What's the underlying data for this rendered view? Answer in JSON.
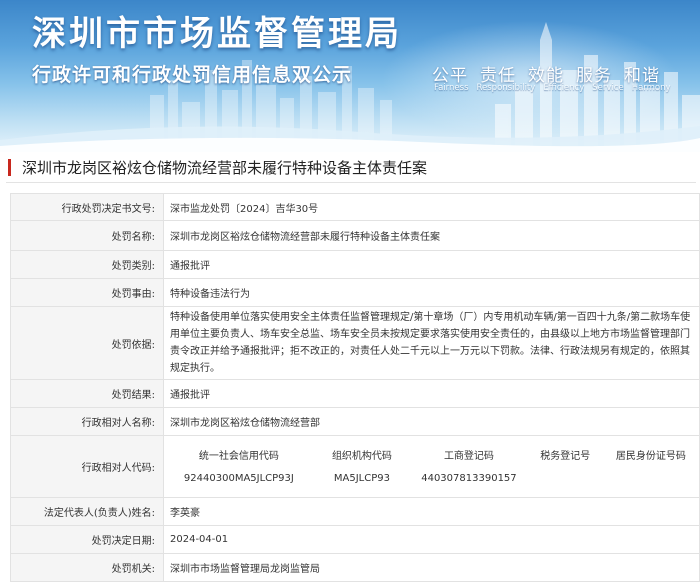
{
  "banner": {
    "title": "深圳市市场监督管理局",
    "subtitle": "行政许可和行政处罚信用信息双公示",
    "slogans": [
      "公平",
      "责任",
      "效能",
      "服务",
      "和谐"
    ],
    "slogans_en": [
      "Fairness",
      "Responsibility",
      "Efficiency",
      "Service",
      "Harmony"
    ]
  },
  "case_title": "深圳市龙岗区裕炫仓储物流经营部未履行特种设备主体责任案",
  "rows": {
    "decision_no": {
      "label": "行政处罚决定书文号:",
      "value": "深市监龙处罚〔2024〕吉华30号"
    },
    "penalty_name": {
      "label": "处罚名称:",
      "value": "深圳市龙岗区裕炫仓储物流经营部未履行特种设备主体责任案"
    },
    "penalty_type": {
      "label": "处罚类别:",
      "value": "通报批评"
    },
    "penalty_reason": {
      "label": "处罚事由:",
      "value": "特种设备违法行为"
    },
    "penalty_basis": {
      "label": "处罚依据:",
      "value": "特种设备使用单位落实使用安全主体责任监督管理规定/第十章场（厂）内专用机动车辆/第一百四十九条/第二款场车使用单位主要负责人、场车安全总监、场车安全员未按规定要求落实使用安全责任的，由县级以上地方市场监督管理部门责令改正并给予通报批评；拒不改正的，对责任人处二千元以上一万元以下罚款。法律、行政法规另有规定的，依照其规定执行。"
    },
    "penalty_result": {
      "label": "处罚结果:",
      "value": "通报批评"
    },
    "counterparty": {
      "label": "行政相对人名称:",
      "value": "深圳市龙岗区裕炫仓储物流经营部"
    },
    "counterparty_code": {
      "label": "行政相对人代码:",
      "headers": [
        "统一社会信用代码",
        "组织机构代码",
        "工商登记码",
        "税务登记号",
        "居民身份证号码"
      ],
      "values": [
        "92440300MA5JLCP93J",
        "MA5JLCP93",
        "440307813390157",
        "",
        ""
      ]
    },
    "legal_rep": {
      "label": "法定代表人(负责人)姓名:",
      "value": "李英豪"
    },
    "decision_date": {
      "label": "处罚决定日期:",
      "value": "2024-04-01"
    },
    "authority": {
      "label": "处罚机关:",
      "value": "深圳市市场监督管理局龙岗监管局"
    }
  }
}
